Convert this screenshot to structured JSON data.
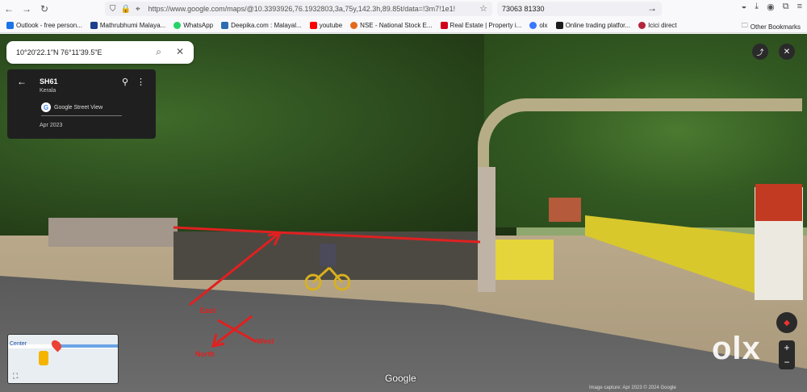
{
  "browser": {
    "url": "https://www.google.com/maps/@10.3393926,76.1932803,3a,75y,142.3h,89.85t/data=!3m7!1e1!3m5",
    "search_text": "73063 81330"
  },
  "bookmarks": [
    {
      "label": "Outlook - free person...",
      "color": "#1a73e8"
    },
    {
      "label": "Mathrubhumi Malaya...",
      "color": "#1c3f8c"
    },
    {
      "label": "WhatsApp",
      "color": "#25d366"
    },
    {
      "label": "Deepika.com : Malayal...",
      "color": "#2b6cb0"
    },
    {
      "label": "youtube",
      "color": "#ff0000"
    },
    {
      "label": "NSE - National Stock E...",
      "color": "#e36a1b"
    },
    {
      "label": "Real Estate | Property i...",
      "color": "#d0021b"
    },
    {
      "label": "olx",
      "color": "#3a77ff"
    },
    {
      "label": "Online trading platfor...",
      "color": "#1b1b1b"
    },
    {
      "label": "Icici direct",
      "color": "#b5243a"
    }
  ],
  "other_bookmarks": "Other Bookmarks",
  "maps": {
    "search_value": "10°20'22.1\"N 76°11'39.5\"E",
    "card_title": "SH61",
    "card_subtitle": "Kerala",
    "card_source": "Google Street View",
    "card_date": "Apr 2023",
    "minimap_label": "Center",
    "google_logo": "Google",
    "footer": "Image capture: Apr 2023   © 2024 Google"
  },
  "annotations": {
    "east": "East",
    "west": "West",
    "north": "North"
  },
  "watermark": "olx",
  "colors": {
    "annotation_red": "#e02020"
  }
}
